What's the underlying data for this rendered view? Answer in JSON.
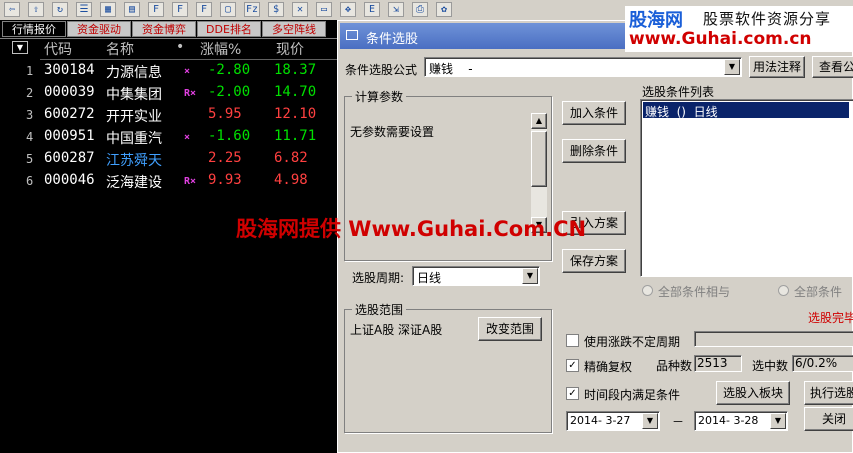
{
  "watermark": {
    "brand": "股海网",
    "tagline": "股票软件资源分享",
    "url": "www.Guhai.com.cn",
    "overlay": "股海网提供 Www.Guhai.Com.CN"
  },
  "toolbar_icons": [
    "left-arrow-icon",
    "up-arrow-icon",
    "refresh-icon",
    "list-icon",
    "grid-icon",
    "chart-icon",
    "f10-icon",
    "f10b-icon",
    "f11-icon",
    "doc-icon",
    "fz-icon",
    "dollar-icon",
    "cross-icon",
    "scroll-icon",
    "move-icon",
    "etf-icon",
    "exit-icon",
    "print-icon",
    "gear-icon"
  ],
  "tabs": [
    "行情报价",
    "资金驱动",
    "资金博弈",
    "DDE排名",
    "多空阵线"
  ],
  "table": {
    "headers": {
      "code": "代码",
      "name": "名称",
      "dot": "•",
      "change": "涨幅%",
      "price": "现价"
    },
    "rows": [
      {
        "idx": "1",
        "code": "300184",
        "name": "力源信息",
        "flag": "×",
        "change": "-2.80",
        "price": "18.37",
        "code_color": "#ffffff",
        "name_color": "#ffffff",
        "change_color": "#00e000",
        "price_color": "#00e000"
      },
      {
        "idx": "2",
        "code": "000039",
        "name": "中集集团",
        "flag": "R×",
        "change": "-2.00",
        "price": "14.70",
        "code_color": "#ffffff",
        "name_color": "#ffffff",
        "change_color": "#00e000",
        "price_color": "#00e000"
      },
      {
        "idx": "3",
        "code": "600272",
        "name": "开开实业",
        "flag": "",
        "change": "5.95",
        "price": "12.10",
        "code_color": "#ffffff",
        "name_color": "#ffffff",
        "change_color": "#ff4040",
        "price_color": "#ff4040"
      },
      {
        "idx": "4",
        "code": "000951",
        "name": "中国重汽",
        "flag": "×",
        "change": "-1.60",
        "price": "11.71",
        "code_color": "#ffffff",
        "name_color": "#ffffff",
        "change_color": "#00e000",
        "price_color": "#00e000"
      },
      {
        "idx": "5",
        "code": "600287",
        "name": "江苏舜天",
        "flag": "",
        "change": "2.25",
        "price": "6.82",
        "code_color": "#ffffff",
        "name_color": "#40a0ff",
        "change_color": "#ff4040",
        "price_color": "#ff4040"
      },
      {
        "idx": "6",
        "code": "000046",
        "name": "泛海建设",
        "flag": "R×",
        "change": "9.93",
        "price": "4.98",
        "code_color": "#ffffff",
        "name_color": "#ffffff",
        "change_color": "#ff4040",
        "price_color": "#ff4040"
      }
    ]
  },
  "dialog": {
    "title": "条件选股",
    "formula_label": "条件选股公式",
    "formula_value": "赚钱    -",
    "usage_btn": "用法注释",
    "view_btn": "查看公",
    "params_group": "计算参数",
    "params_text": "无参数需要设置",
    "add_btn": "加入条件",
    "del_btn": "删除条件",
    "import_btn": "引入方案",
    "save_btn": "保存方案",
    "list_label": "选股条件列表",
    "list_item": "赚钱  ()  日线",
    "period_label": "选股周期:",
    "period_value": "日线",
    "radio_and": "全部条件相与",
    "radio_or": "全部条件",
    "done_text": "选股完毕",
    "range_group": "选股范围",
    "range_text": "上证A股 深证A股",
    "range_btn": "改变范围",
    "uncertain_label": "使用涨跌不定周期",
    "exact_label": "精确复权",
    "count_label": "品种数",
    "count_value": "2513",
    "selected_label": "选中数",
    "selected_value": "6/0.2%",
    "period_cond_label": "时间段内满足条件",
    "to_board_btn": "选股入板块",
    "exec_btn": "执行选股",
    "date_from": "2014- 3-27",
    "date_sep": "－",
    "date_to": "2014- 3-28",
    "close_btn": "关闭"
  },
  "colors": {
    "accent": "#0a246a",
    "up": "#ff4040",
    "down": "#00e000",
    "watermark": "#d00000"
  }
}
